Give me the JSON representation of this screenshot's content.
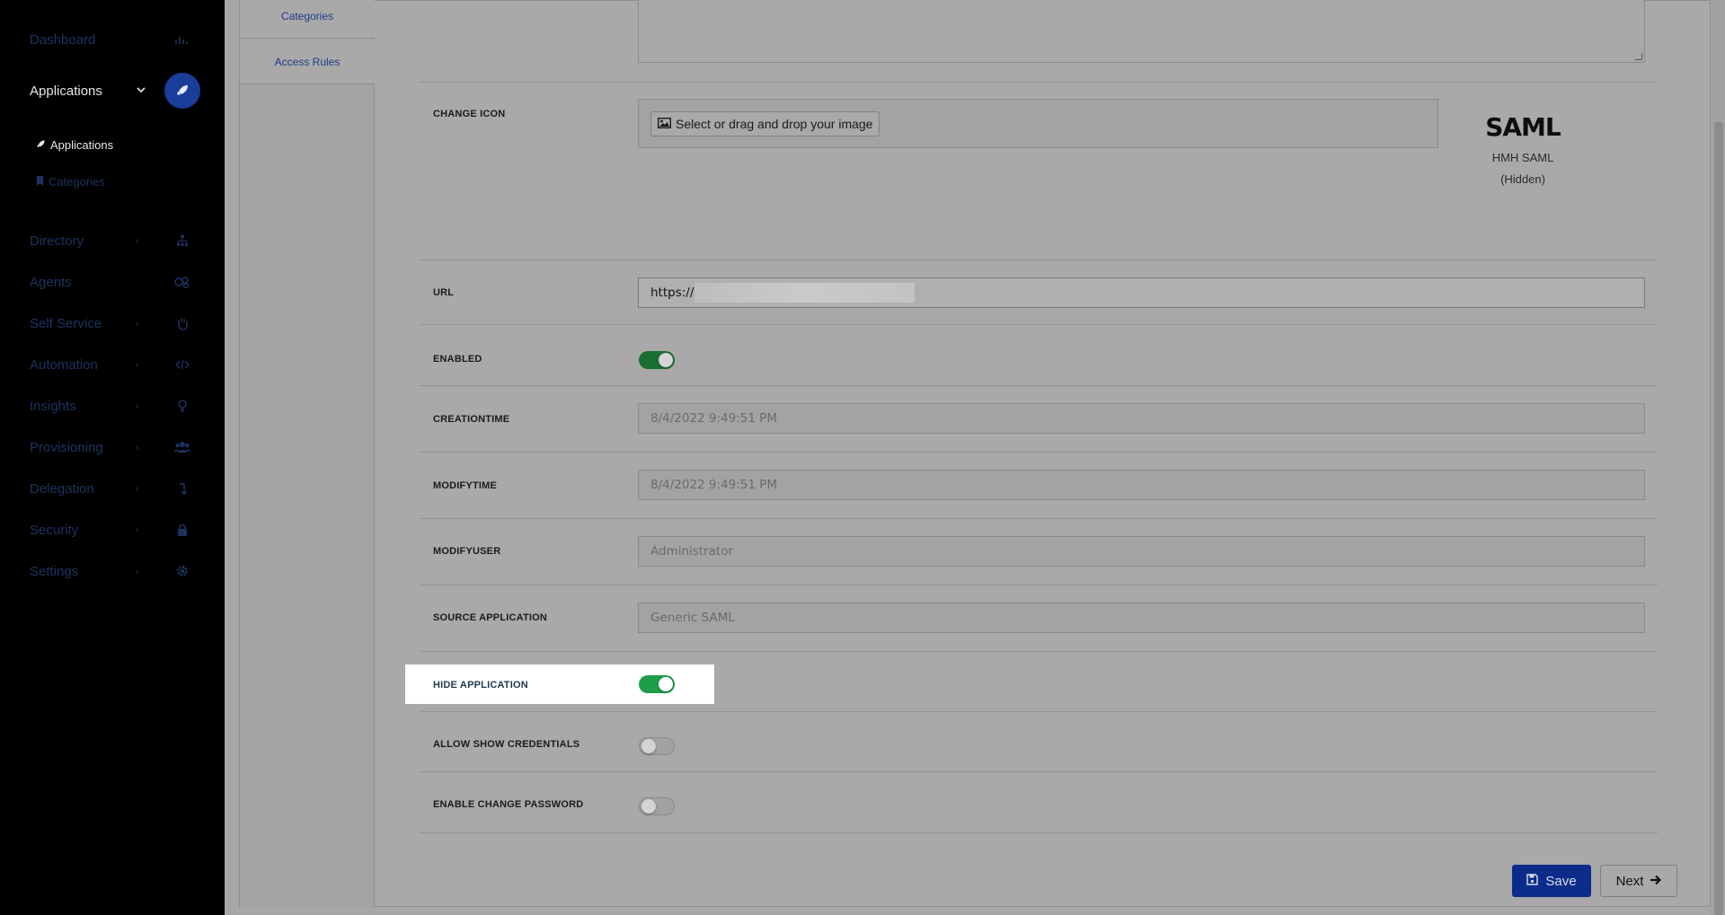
{
  "sidebar": {
    "items": [
      {
        "label": "Dashboard",
        "icon": "dashboard-icon",
        "has_chevron": false
      },
      {
        "label": "Applications",
        "icon": "rocket-icon",
        "has_chevron": true,
        "active": true
      },
      {
        "label": "Directory",
        "icon": "sitemap-icon",
        "has_chevron": true
      },
      {
        "label": "Agents",
        "icon": "agents-icon",
        "has_chevron": false
      },
      {
        "label": "Self Service",
        "icon": "hand-icon",
        "has_chevron": true
      },
      {
        "label": "Automation",
        "icon": "code-icon",
        "has_chevron": true
      },
      {
        "label": "Insights",
        "icon": "lightbulb-icon",
        "has_chevron": true
      },
      {
        "label": "Provisioning",
        "icon": "users-icon",
        "has_chevron": true
      },
      {
        "label": "Delegation",
        "icon": "delegation-icon",
        "has_chevron": true
      },
      {
        "label": "Security",
        "icon": "lock-icon",
        "has_chevron": true
      },
      {
        "label": "Settings",
        "icon": "gear-icon",
        "has_chevron": true
      }
    ],
    "sub_items": [
      {
        "label": "Applications",
        "icon": "rocket-icon"
      },
      {
        "label": "Categories",
        "icon": "bookmark-icon"
      }
    ]
  },
  "left_tabs": [
    "Categories",
    "Access Rules"
  ],
  "form": {
    "change_icon": {
      "label": "CHANGE ICON",
      "button": "Select or drag and drop your image",
      "preview_logo": "SAML",
      "preview_name": "HMH SAML",
      "preview_status": "(Hidden)"
    },
    "url": {
      "label": "URL",
      "value": "https://"
    },
    "enabled": {
      "label": "ENABLED",
      "on": true
    },
    "creationtime": {
      "label": "CREATIONTIME",
      "value": "8/4/2022 9:49:51 PM"
    },
    "modifytime": {
      "label": "MODIFYTIME",
      "value": "8/4/2022 9:49:51 PM"
    },
    "modifyuser": {
      "label": "MODIFYUSER",
      "value": "Administrator"
    },
    "source_application": {
      "label": "SOURCE APPLICATION",
      "value": "Generic SAML"
    },
    "hide_application": {
      "label": "HIDE APPLICATION",
      "on": true
    },
    "allow_show_credentials": {
      "label": "ALLOW SHOW CREDENTIALS",
      "on": false
    },
    "enable_change_password": {
      "label": "ENABLE CHANGE PASSWORD",
      "on": false
    }
  },
  "actions": {
    "save": "Save",
    "next": "Next"
  },
  "colors": {
    "sidebar_bg": "#000000",
    "active_circle": "#1a3d9a",
    "toggle_on": "#1e9d4b",
    "save_button": "#0b2c8a"
  }
}
